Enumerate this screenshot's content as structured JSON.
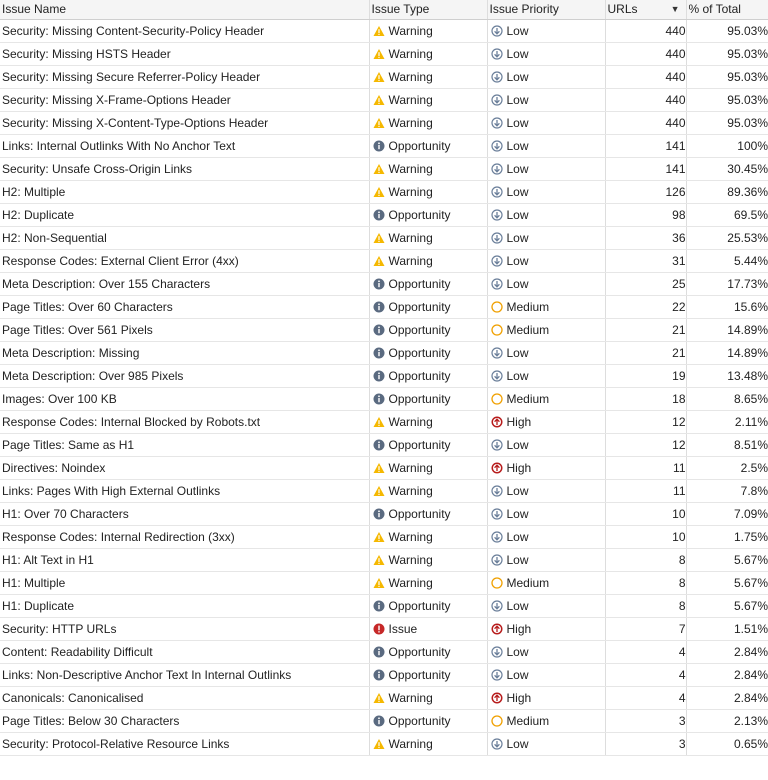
{
  "columns": {
    "name": "Issue Name",
    "type": "Issue Type",
    "priority": "Issue Priority",
    "urls": "URLs",
    "percent": "% of Total"
  },
  "icons": {
    "Warning": "warning-icon",
    "Opportunity": "info-icon",
    "Issue": "error-icon",
    "Low": "arrow-down-circle-icon",
    "Medium": "circle-outline-icon",
    "High": "arrow-up-circle-icon"
  },
  "colors": {
    "warning": "#f5b800",
    "opportunity": "#5a6a80",
    "issue": "#c62828",
    "low": "#6b7f9a",
    "medium": "#f0a000",
    "high": "#b71c1c"
  },
  "rows": [
    {
      "name": "Security: Missing Content-Security-Policy Header",
      "type": "Warning",
      "priority": "Low",
      "urls": "440",
      "percent": "95.03%"
    },
    {
      "name": "Security: Missing HSTS Header",
      "type": "Warning",
      "priority": "Low",
      "urls": "440",
      "percent": "95.03%"
    },
    {
      "name": "Security: Missing Secure Referrer-Policy Header",
      "type": "Warning",
      "priority": "Low",
      "urls": "440",
      "percent": "95.03%"
    },
    {
      "name": "Security: Missing X-Frame-Options Header",
      "type": "Warning",
      "priority": "Low",
      "urls": "440",
      "percent": "95.03%"
    },
    {
      "name": "Security: Missing X-Content-Type-Options Header",
      "type": "Warning",
      "priority": "Low",
      "urls": "440",
      "percent": "95.03%"
    },
    {
      "name": "Links: Internal Outlinks With No Anchor Text",
      "type": "Opportunity",
      "priority": "Low",
      "urls": "141",
      "percent": "100%"
    },
    {
      "name": "Security: Unsafe Cross-Origin Links",
      "type": "Warning",
      "priority": "Low",
      "urls": "141",
      "percent": "30.45%"
    },
    {
      "name": "H2: Multiple",
      "type": "Warning",
      "priority": "Low",
      "urls": "126",
      "percent": "89.36%"
    },
    {
      "name": "H2: Duplicate",
      "type": "Opportunity",
      "priority": "Low",
      "urls": "98",
      "percent": "69.5%"
    },
    {
      "name": "H2: Non-Sequential",
      "type": "Warning",
      "priority": "Low",
      "urls": "36",
      "percent": "25.53%"
    },
    {
      "name": "Response Codes: External Client Error (4xx)",
      "type": "Warning",
      "priority": "Low",
      "urls": "31",
      "percent": "5.44%"
    },
    {
      "name": "Meta Description: Over 155 Characters",
      "type": "Opportunity",
      "priority": "Low",
      "urls": "25",
      "percent": "17.73%"
    },
    {
      "name": "Page Titles: Over 60 Characters",
      "type": "Opportunity",
      "priority": "Medium",
      "urls": "22",
      "percent": "15.6%"
    },
    {
      "name": "Page Titles: Over 561 Pixels",
      "type": "Opportunity",
      "priority": "Medium",
      "urls": "21",
      "percent": "14.89%"
    },
    {
      "name": "Meta Description: Missing",
      "type": "Opportunity",
      "priority": "Low",
      "urls": "21",
      "percent": "14.89%"
    },
    {
      "name": "Meta Description: Over 985 Pixels",
      "type": "Opportunity",
      "priority": "Low",
      "urls": "19",
      "percent": "13.48%"
    },
    {
      "name": "Images: Over 100 KB",
      "type": "Opportunity",
      "priority": "Medium",
      "urls": "18",
      "percent": "8.65%"
    },
    {
      "name": "Response Codes: Internal Blocked by Robots.txt",
      "type": "Warning",
      "priority": "High",
      "urls": "12",
      "percent": "2.11%"
    },
    {
      "name": "Page Titles: Same as H1",
      "type": "Opportunity",
      "priority": "Low",
      "urls": "12",
      "percent": "8.51%"
    },
    {
      "name": "Directives: Noindex",
      "type": "Warning",
      "priority": "High",
      "urls": "11",
      "percent": "2.5%"
    },
    {
      "name": "Links: Pages With High External Outlinks",
      "type": "Warning",
      "priority": "Low",
      "urls": "11",
      "percent": "7.8%"
    },
    {
      "name": "H1: Over 70 Characters",
      "type": "Opportunity",
      "priority": "Low",
      "urls": "10",
      "percent": "7.09%"
    },
    {
      "name": "Response Codes: Internal Redirection (3xx)",
      "type": "Warning",
      "priority": "Low",
      "urls": "10",
      "percent": "1.75%"
    },
    {
      "name": "H1: Alt Text in H1",
      "type": "Warning",
      "priority": "Low",
      "urls": "8",
      "percent": "5.67%"
    },
    {
      "name": "H1: Multiple",
      "type": "Warning",
      "priority": "Medium",
      "urls": "8",
      "percent": "5.67%"
    },
    {
      "name": "H1: Duplicate",
      "type": "Opportunity",
      "priority": "Low",
      "urls": "8",
      "percent": "5.67%"
    },
    {
      "name": "Security: HTTP URLs",
      "type": "Issue",
      "priority": "High",
      "urls": "7",
      "percent": "1.51%"
    },
    {
      "name": "Content: Readability Difficult",
      "type": "Opportunity",
      "priority": "Low",
      "urls": "4",
      "percent": "2.84%"
    },
    {
      "name": "Links: Non-Descriptive Anchor Text In Internal Outlinks",
      "type": "Opportunity",
      "priority": "Low",
      "urls": "4",
      "percent": "2.84%"
    },
    {
      "name": "Canonicals: Canonicalised",
      "type": "Warning",
      "priority": "High",
      "urls": "4",
      "percent": "2.84%"
    },
    {
      "name": "Page Titles: Below 30 Characters",
      "type": "Opportunity",
      "priority": "Medium",
      "urls": "3",
      "percent": "2.13%"
    },
    {
      "name": "Security: Protocol-Relative Resource Links",
      "type": "Warning",
      "priority": "Low",
      "urls": "3",
      "percent": "0.65%"
    }
  ]
}
